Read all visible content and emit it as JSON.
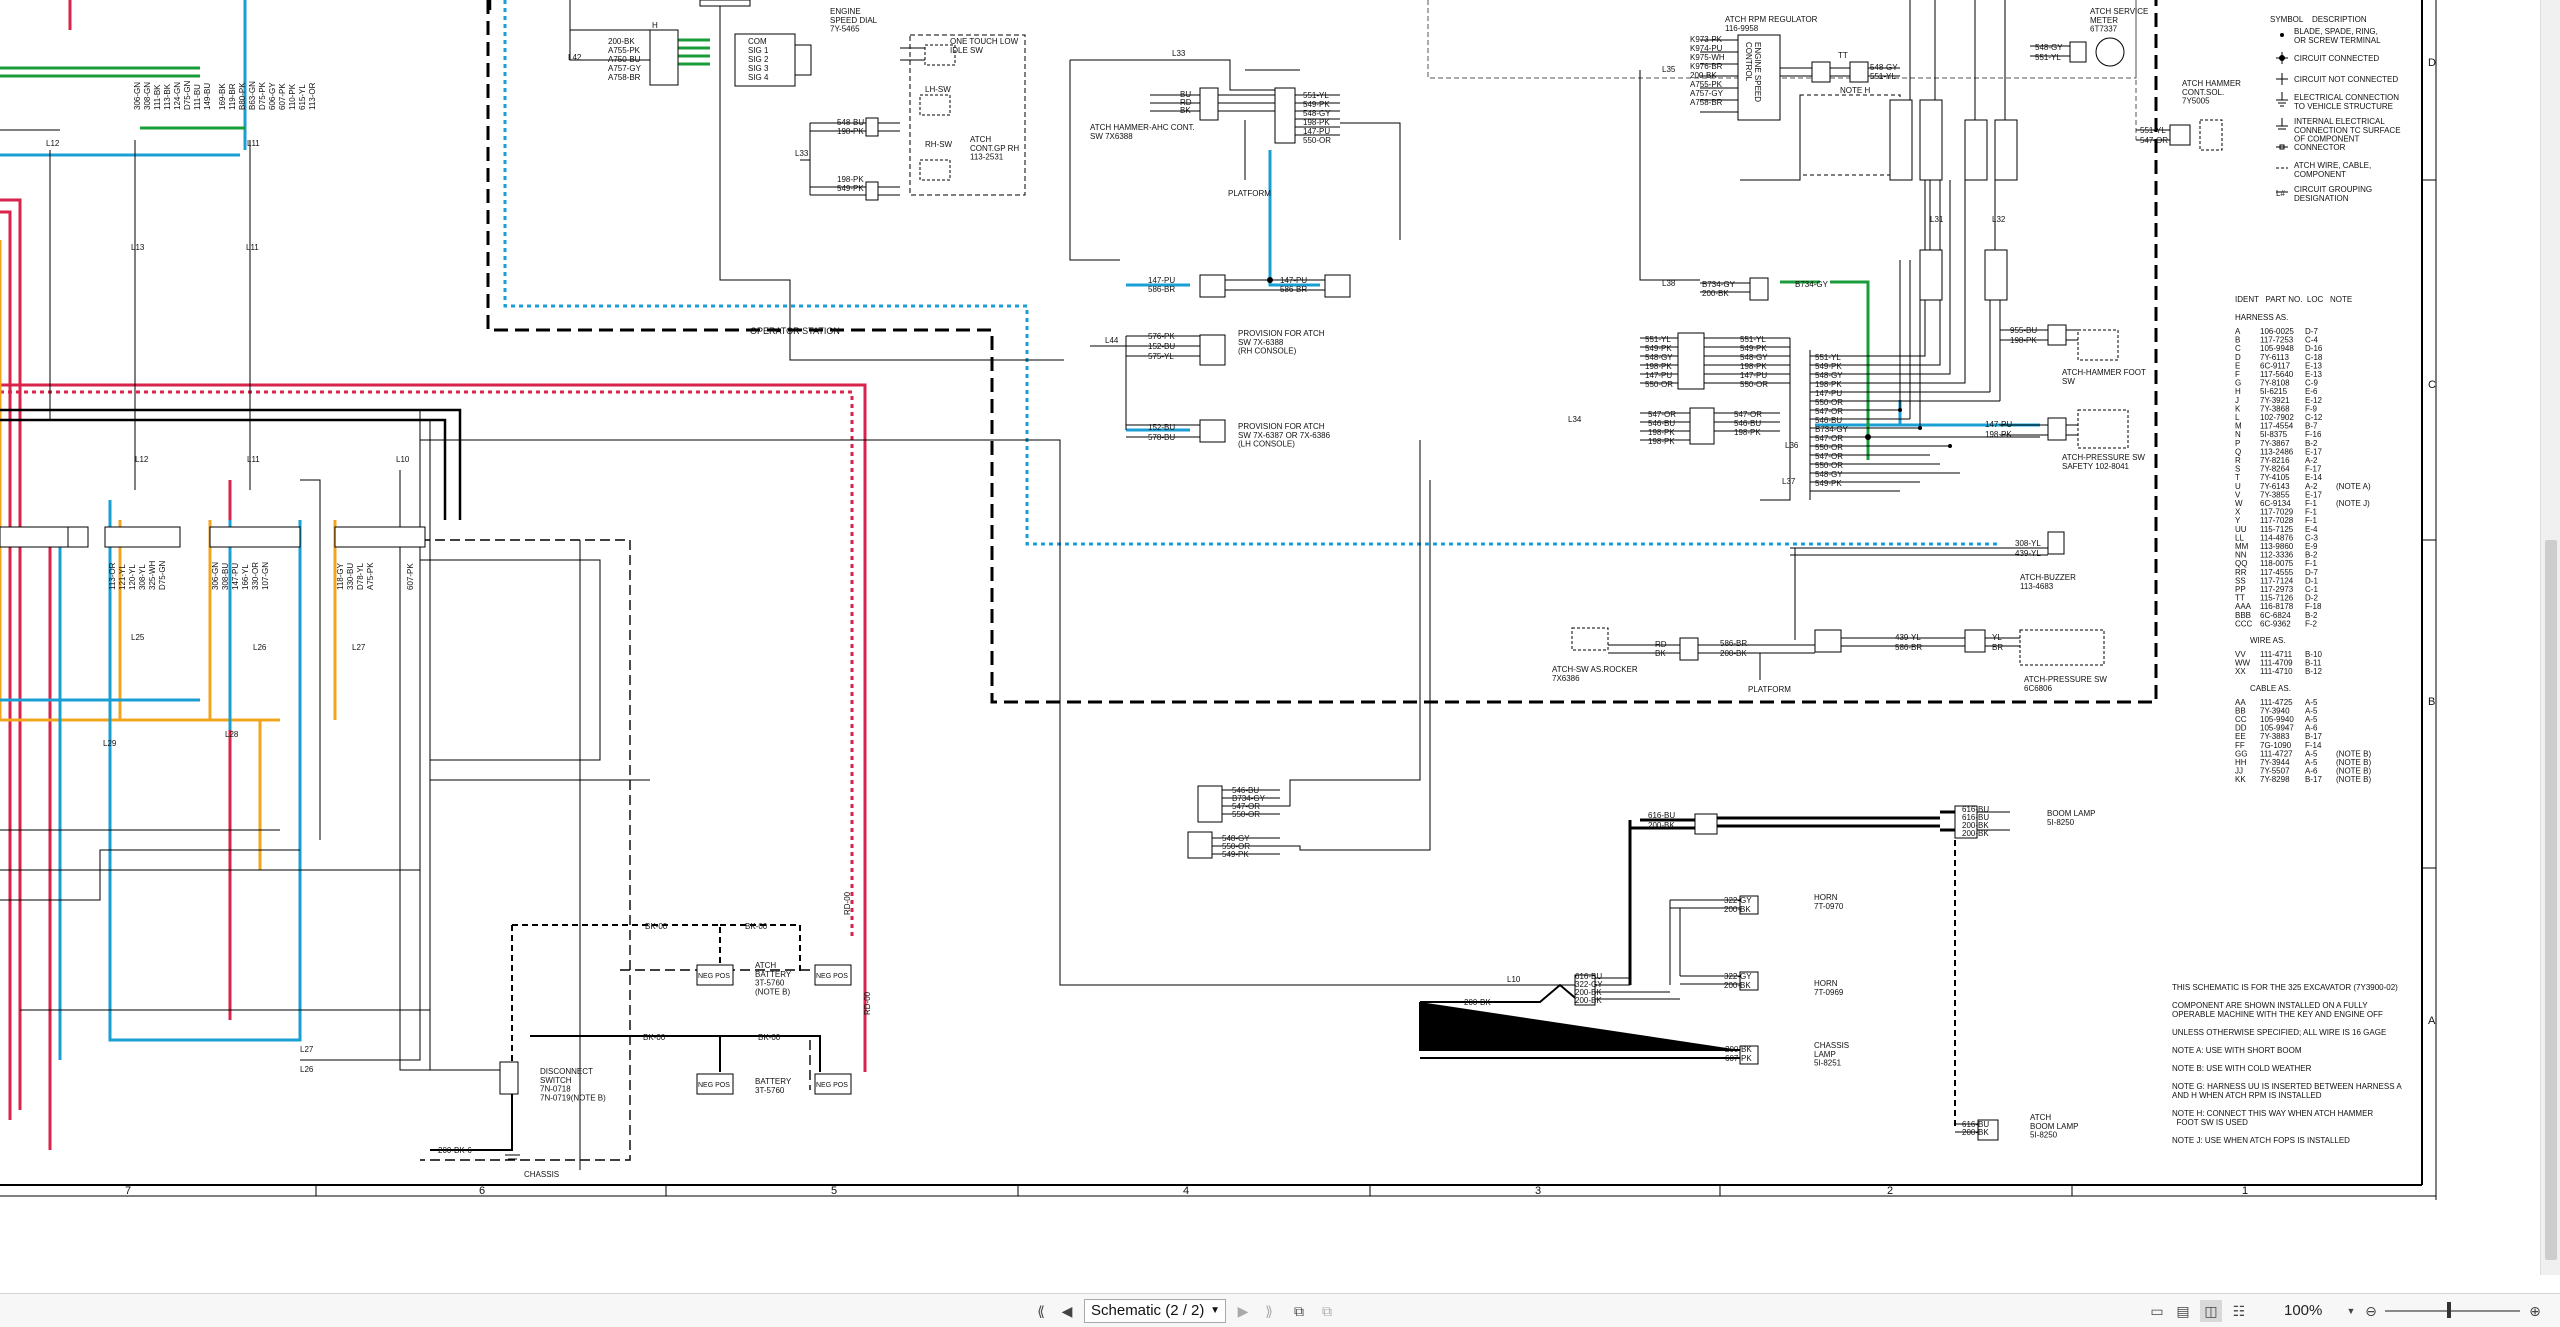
{
  "viewer": {
    "page_label": "Schematic (2 / 2)",
    "zoom": "100%",
    "icons": {
      "first": "first-page-icon",
      "prev": "previous-page-icon",
      "next": "next-page-icon",
      "last": "last-page-icon",
      "zoom_out": "zoom-out-icon",
      "zoom_in": "zoom-in-icon"
    }
  },
  "schematic": {
    "col_numbers": [
      "7",
      "6",
      "5",
      "4",
      "3",
      "2",
      "1"
    ],
    "row_letters": [
      "D",
      "C",
      "B",
      "A"
    ],
    "labels": {
      "engine_speed_dial": "ENGINE\nSPEED DIAL\n7Y-5465",
      "one_touch": "ONE TOUCH LOW\nIDLE SW",
      "lh_sw": "LH-SW",
      "rh_sw": "RH-SW",
      "atch_cont": "ATCH\nCONT.GP RH\n113-2531",
      "hammer_ahc": "ATCH HAMMER-AHC CONT.\nSW 7X6388",
      "platform": "PLATFORM",
      "prov_rh": "PROVISION FOR ATCH\nSW 7X-6388\n(RH CONSOLE)",
      "prov_lh": "PROVISION FOR ATCH\nSW 7X-6387 OR 7X-6386\n(LH CONSOLE)",
      "operator_station": "OPERATOR STATION",
      "rpm_regulator": "ATCH RPM REGULATOR\n116-9958",
      "engine_speed_control": "ENGINE SPEED\nCONTROL",
      "service_meter": "ATCH SERVICE\nMETER\n6T7337",
      "hammer_sol": "ATCH HAMMER\nCONT.SOL.\n7Y5005",
      "hammer_foot": "ATCH-HAMMER FOOT\nSW",
      "pressure_safety": "ATCH-PRESSURE SW\nSAFETY 102-8041",
      "buzzer": "ATCH-BUZZER\n113-4683",
      "rocker": "ATCH-SW AS.ROCKER\n7X6386",
      "platform2": "PLATFORM",
      "pressure_sw": "ATCH-PRESSURE SW\n6C6806",
      "boom_lamp": "BOOM LAMP\n5I-8250",
      "horn1": "HORN\n7T-0970",
      "horn2": "HORN\n7T-0969",
      "chassis_lamp": "CHASSIS\nLAMP\n5I-8251",
      "atch_boom_lamp": "ATCH\nBOOM LAMP\n5I-8250",
      "atch_battery": "ATCH\nBATTERY\n3T-5760\n(NOTE B)",
      "battery": "BATTERY\n3T-5760",
      "disconnect": "DISCONNECT\nSWITCH\n7N-0718\n7N-0719(NOTE B)",
      "chassis": "CHASSIS",
      "neg_pos_1": "NEG POS",
      "neg_pos_2": "NEG POS",
      "neg_pos_3": "NEG POS",
      "neg_pos_4": "NEG POS"
    },
    "legend": {
      "header": "SYMBOL    DESCRIPTION",
      "items": [
        "BLADE, SPADE, RING,\nOR SCREW TERMINAL",
        "CIRCUIT CONNECTED",
        "CIRCUIT NOT CONNECTED",
        "ELECTRICAL CONNECTION\nTO VEHICLE STRUCTURE",
        "INTERNAL ELECTRICAL\nCONNECTION TC SURFACE\nOF COMPONENT",
        "CONNECTOR",
        "ATCH WIRE, CABLE,\nCOMPONENT",
        "CIRCUIT GROUPING\nDESIGNATION"
      ]
    },
    "ident_table": {
      "header": "IDENT   PART NO.  LOC   NOTE",
      "harness_title": "HARNESS AS.",
      "harness": [
        [
          "A",
          "106-0025",
          "D-7",
          ""
        ],
        [
          "B",
          "117-7253",
          "C-4",
          ""
        ],
        [
          "C",
          "105-9948",
          "D-16",
          ""
        ],
        [
          "D",
          "7Y-6113",
          "C-18",
          ""
        ],
        [
          "E",
          "6C-9117",
          "E-13",
          ""
        ],
        [
          "F",
          "117-5640",
          "E-13",
          ""
        ],
        [
          "G",
          "7Y-8108",
          "C-9",
          ""
        ],
        [
          "H",
          "5I-6215",
          "E-6",
          ""
        ],
        [
          "J",
          "7Y-3921",
          "E-12",
          ""
        ],
        [
          "K",
          "7Y-3868",
          "F-9",
          ""
        ],
        [
          "L",
          "102-7902",
          "C-12",
          ""
        ],
        [
          "M",
          "117-4554",
          "B-7",
          ""
        ],
        [
          "N",
          "5I-8375",
          "F-16",
          ""
        ],
        [
          "P",
          "7Y-3867",
          "B-2",
          ""
        ],
        [
          "Q",
          "113-2486",
          "E-17",
          ""
        ],
        [
          "R",
          "7Y-8216",
          "A-2",
          ""
        ],
        [
          "S",
          "7Y-8264",
          "F-17",
          ""
        ],
        [
          "T",
          "7Y-4105",
          "E-14",
          ""
        ],
        [
          "U",
          "7Y-6143",
          "A-2",
          "(NOTE A)"
        ],
        [
          "V",
          "7Y-3855",
          "E-17",
          ""
        ],
        [
          "W",
          "6C-9134",
          "F-1",
          "(NOTE J)"
        ],
        [
          "X",
          "117-7029",
          "F-1",
          ""
        ],
        [
          "Y",
          "117-7028",
          "F-1",
          ""
        ],
        [
          "UU",
          "115-7125",
          "E-4",
          ""
        ],
        [
          "LL",
          "114-4876",
          "C-3",
          ""
        ],
        [
          "MM",
          "113-9860",
          "E-9",
          ""
        ],
        [
          "NN",
          "112-3336",
          "B-2",
          ""
        ],
        [
          "QQ",
          "118-0075",
          "F-1",
          ""
        ],
        [
          "RR",
          "117-4555",
          "D-7",
          ""
        ],
        [
          "SS",
          "117-7124",
          "D-1",
          ""
        ],
        [
          "PP",
          "117-2973",
          "C-1",
          ""
        ],
        [
          "TT",
          "115-7126",
          "D-2",
          ""
        ],
        [
          "AAA",
          "116-8178",
          "F-18",
          ""
        ],
        [
          "BBB",
          "6C-6824",
          "B-2",
          ""
        ],
        [
          "CCC",
          "6C-9362",
          "F-2",
          ""
        ]
      ],
      "wire_title": "WIRE AS.",
      "wire": [
        [
          "VV",
          "111-4711",
          "B-10",
          ""
        ],
        [
          "WW",
          "111-4709",
          "B-11",
          ""
        ],
        [
          "XX",
          "111-4710",
          "B-12",
          ""
        ]
      ],
      "cable_title": "CABLE AS.",
      "cable": [
        [
          "AA",
          "111-4725",
          "A-5",
          ""
        ],
        [
          "BB",
          "7Y-3940",
          "A-5",
          ""
        ],
        [
          "CC",
          "105-9940",
          "A-5",
          ""
        ],
        [
          "DD",
          "105-9947",
          "A-6",
          ""
        ],
        [
          "EE",
          "7Y-3883",
          "B-17",
          ""
        ],
        [
          "FF",
          "7G-1090",
          "F-14",
          ""
        ],
        [
          "GG",
          "111-4727",
          "A-5",
          "(NOTE B)"
        ],
        [
          "HH",
          "7Y-3944",
          "A-5",
          "(NOTE B)"
        ],
        [
          "JJ",
          "7Y-5507",
          "A-6",
          "(NOTE B)"
        ],
        [
          "KK",
          "7Y-8298",
          "B-17",
          "(NOTE B)"
        ]
      ]
    },
    "notes": [
      "THIS SCHEMATIC IS FOR THE 325 EXCAVATOR (7Y3900-02)",
      "COMPONENT ARE SHOWN INSTALLED ON A FULLY\nOPERABLE MACHINE WITH THE KEY AND ENGINE OFF",
      "UNLESS OTHERWISE SPECIFIED; ALL WIRE IS 16 GAGE",
      "NOTE A: USE WITH SHORT BOOM",
      "NOTE B: USE WITH COLD WEATHER",
      "NOTE G: HARNESS UU IS INSERTED BETWEEN HARNESS A\nAND H WHEN ATCH RPM IS INSTALLED",
      "NOTE H: CONNECT THIS WAY WHEN ATCH HAMMER\n  FOOT SW IS USED",
      "NOTE J: USE WHEN ATCH FOPS IS INSTALLED"
    ],
    "wire_labels": {
      "dial": [
        "200-BK",
        "A755-PK",
        "A750-BU",
        "A757-GY",
        "A758-BR"
      ],
      "dial_sig": [
        "COM",
        "SIG 1",
        "SIG 2",
        "SIG 3",
        "SIG 4"
      ],
      "l33_top": [
        "548-BU",
        "198-PK"
      ],
      "l33_bot": [
        "198-PK",
        "549-PK"
      ],
      "ahc": [
        "551-YL",
        "549-PK",
        "548-GY",
        "198-PK",
        "147-PU",
        "550-OR"
      ],
      "ahc_left": [
        "BU",
        "RD",
        "BK"
      ],
      "prov_rh_a": [
        "147-PU",
        "586-BR"
      ],
      "prov_rh_b": [
        "147-PU",
        "586-BR"
      ],
      "prov_l44": [
        "576-PK",
        "152-BU",
        "575-YL"
      ],
      "prov_lh": [
        "152-BU",
        "578-BU"
      ],
      "rpm": [
        "K973-PK",
        "K974-PU",
        "K975-WH",
        "K976-BR",
        "200-BK",
        "A755-PK",
        "A757-GY",
        "A758-BR"
      ],
      "rpm_tt": [
        "548-GY",
        "551-YL"
      ],
      "meter": [
        "548-GY",
        "551-YL"
      ],
      "sol": [
        "551-YL",
        "547-OR"
      ],
      "l38": [
        "B734-GY",
        "200-BK"
      ],
      "l38_right": "B734-GY",
      "bpp_left": [
        "551-YL",
        "549-PK",
        "548-GY",
        "198-PK",
        "147-PU",
        "550-OR"
      ],
      "bpp_right": [
        "551-YL",
        "549-PK",
        "548-GY",
        "198-PK",
        "147-PU",
        "550-OR"
      ],
      "l34_left": [
        "547-OR",
        "546-BU",
        "198-PK",
        "198-PK"
      ],
      "l34_right": [
        "547-OR",
        "546-BU",
        "198-PK"
      ],
      "bus": [
        "551-YL",
        "549-PK",
        "548-GY",
        "198-PK",
        "147-PU",
        "550-OR",
        "547-OR",
        "546-BU",
        "B734-GY",
        "547-OR",
        "550-OR",
        "547-OR",
        "550-OR",
        "548-GY",
        "549-PK"
      ],
      "foot": [
        "955-BU",
        "198-PK"
      ],
      "safety": [
        "147-PU",
        "198-PK"
      ],
      "buzzer": [
        "308-YL",
        "439-YL"
      ],
      "nn": [
        "586-BR",
        "200-BK"
      ],
      "nn_left": [
        "RD",
        "BK"
      ],
      "bbb": [
        "439-YL",
        "586-BR"
      ],
      "bbb_right": [
        "YL",
        "BR"
      ],
      "pp_left": [
        "546-BU",
        "B734-GY",
        "547-OR",
        "550-OR"
      ],
      "pp_left2": [
        "548-GY",
        "550-OR",
        "549-PK"
      ],
      "rr_p": [
        "616-BU",
        "200-BK"
      ],
      "boom": [
        "616-BU",
        "616-BU",
        "200-BK",
        "200-BK"
      ],
      "horn1": [
        "322-GY",
        "200-BK"
      ],
      "horn2": [
        "322-GY",
        "200-BK"
      ],
      "l10": [
        "616-BU",
        "322-GY",
        "200-BK",
        "200-BK"
      ],
      "l10_left": "200-BK",
      "chassis_lamp": [
        "200-BK",
        "607-PK"
      ],
      "atch_boom": [
        "616-BU",
        "200-BK"
      ],
      "bat": [
        "BK-00",
        "BK-00",
        "BK-00",
        "BK-00",
        "RD-00",
        "RD-00",
        "200-BK-6"
      ],
      "harness_bottom": [
        "113-OR",
        "121-YL",
        "120-YL",
        "308-YL",
        "325-WH",
        "D75-GN",
        "306-GN",
        "308-BU",
        "147-PU",
        "166-YL",
        "330-OR",
        "107-GN",
        "118-GY",
        "330-BU",
        "D78-YL",
        "A75-PK",
        "607-PK"
      ],
      "harness_top": [
        "306-GN",
        "308-GN",
        "111-BK",
        "113-BK",
        "124-GN",
        "D75-GN",
        "111-BU",
        "149-BU",
        "169-BK",
        "119-BR",
        "B80-PK",
        "B63-GN",
        "D75-PK",
        "606-GY",
        "607-PK",
        "110-PK",
        "615-YL",
        "113-OR"
      ],
      "groups": [
        "L12",
        "L11",
        "L13",
        "L11",
        "L25",
        "L26",
        "L27",
        "L28",
        "L29",
        "L26",
        "L27",
        "L10",
        "L11",
        "L12",
        "L31",
        "L32",
        "L33",
        "L35",
        "L36",
        "L37",
        "L38",
        "L34",
        "L42",
        "L44"
      ],
      "letters": [
        "H",
        "J",
        "B",
        "J",
        "J",
        "J",
        "TT",
        "NOTE H",
        "PP",
        "PP",
        "B",
        "B",
        "PP",
        "LL",
        "PP",
        "NN",
        "BBB",
        "BBB",
        "MM",
        "RR",
        "P",
        "RR",
        "RR",
        "RR",
        "SS",
        "P",
        "R",
        "V",
        "JJ",
        "HH",
        "GG",
        "CC",
        "CC",
        "BB",
        "AA",
        "DD",
        "RR",
        "RR",
        "M",
        "M",
        "RR"
      ]
    }
  }
}
